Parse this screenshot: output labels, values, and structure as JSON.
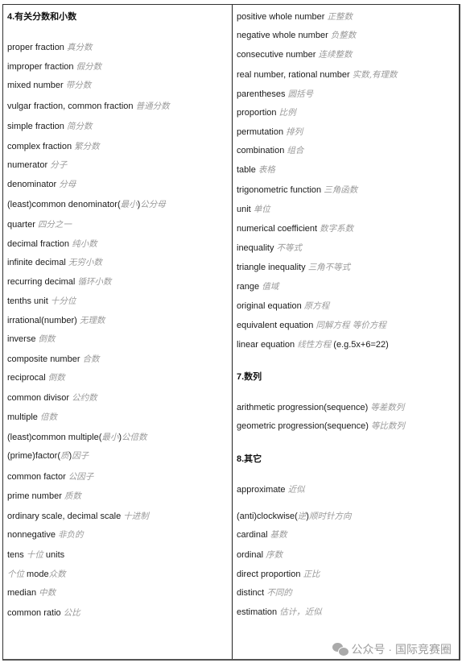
{
  "left_column": {
    "heading": "4.有关分数和小数",
    "items": [
      {
        "en": "proper fraction",
        "zh": "真分数"
      },
      {
        "en": "improper fraction",
        "zh": "假分数"
      },
      {
        "en": "mixed number",
        "zh": "带分数"
      },
      {
        "en": "vulgar fraction, common fraction",
        "zh": "普通分数"
      },
      {
        "en": "simple fraction",
        "zh": "简分数"
      },
      {
        "en": "complex fraction",
        "zh": "繁分数"
      },
      {
        "en": "numerator",
        "zh": "分子"
      },
      {
        "en": "denominator",
        "zh": "分母"
      },
      {
        "en": "(least)common denominator(",
        "zh": "最小",
        "en2": ")",
        "zh2": "公分母"
      },
      {
        "en": "quarter",
        "zh": "四分之一"
      },
      {
        "en": "decimal fraction",
        "zh": "纯小数"
      },
      {
        "en": "infinite decimal",
        "zh": "无穷小数"
      },
      {
        "en": "recurring decimal",
        "zh": "循环小数"
      },
      {
        "en": "tenths unit",
        "zh": "十分位"
      },
      {
        "en": "irrational(number)",
        "zh": "无理数"
      },
      {
        "en": "inverse",
        "zh": "倒数"
      },
      {
        "en": "composite number",
        "zh": "合数"
      },
      {
        "en": "reciprocal",
        "zh": "倒数"
      },
      {
        "en": "common divisor",
        "zh": "公约数"
      },
      {
        "en": "multiple",
        "zh": "倍数"
      },
      {
        "en": "(least)common multiple(",
        "zh": "最小",
        "en2": ")",
        "zh2": "公倍数"
      },
      {
        "en": "(prime)factor(",
        "zh": "质",
        "en2": ")",
        "zh2": "因子"
      },
      {
        "en": "common factor",
        "zh": "公因子"
      },
      {
        "en": "prime number",
        "zh": "质数"
      },
      {
        "en": "ordinary scale, decimal scale",
        "zh": "十进制"
      },
      {
        "en": "nonnegative",
        "zh": "非负的"
      },
      {
        "en": "tens",
        "zh": "十位",
        "en2": " units"
      },
      {
        "en": "",
        "zh": "个位",
        "en2": " mode",
        "zh2": "众数"
      },
      {
        "en": "median",
        "zh": "中数"
      },
      {
        "en": "common ratio",
        "zh": "公比"
      }
    ]
  },
  "right_column": {
    "items": [
      {
        "en": "positive whole number",
        "zh": "正整数"
      },
      {
        "en": "negative whole number",
        "zh": "负整数"
      },
      {
        "en": "consecutive number",
        "zh": "连续整数"
      },
      {
        "en": "real number, rational number",
        "zh": "实数,有理数"
      },
      {
        "en": "parentheses",
        "zh": "圆括号"
      },
      {
        "en": "proportion",
        "zh": "比例"
      },
      {
        "en": "permutation",
        "zh": "排列"
      },
      {
        "en": "combination",
        "zh": "组合"
      },
      {
        "en": "table",
        "zh": "表格"
      },
      {
        "en": "trigonometric function",
        "zh": "三角函数"
      },
      {
        "en": "unit",
        "zh": "单位"
      },
      {
        "en": "numerical coefficient",
        "zh": "数字系数"
      },
      {
        "en": "inequality",
        "zh": "不等式"
      },
      {
        "en": "triangle inequality",
        "zh": "三角不等式"
      },
      {
        "en": "range",
        "zh": "值域"
      },
      {
        "en": "original equation",
        "zh": "原方程"
      },
      {
        "en": "equivalent equation",
        "zh": "同解方程 等价方程"
      },
      {
        "en": "linear equation",
        "zh": "线性方程",
        "en2": " (e.g.5x+6=22)"
      }
    ],
    "heading_sequences": "7.数列",
    "sequence_items": [
      {
        "en": "arithmetic progression(sequence)",
        "zh": "等差数列"
      },
      {
        "en": "geometric progression(sequence)",
        "zh": "等比数列"
      }
    ],
    "heading_other": "8.其它",
    "other_items": [
      {
        "en": "approximate",
        "zh": "近似"
      },
      {
        "en": "(anti)clockwise(",
        "zh": "逆",
        "en2": ")",
        "zh2": "顺时针方向"
      },
      {
        "en": "cardinal",
        "zh": "基数"
      },
      {
        "en": "ordinal",
        "zh": "序数"
      },
      {
        "en": "direct proportion",
        "zh": "正比"
      },
      {
        "en": "distinct",
        "zh": "不同的"
      },
      {
        "en": "estimation",
        "zh": "估计，近似"
      }
    ]
  },
  "watermark": {
    "icon": "wechat-icon",
    "text": "公众号 · 国际竞赛圈"
  }
}
